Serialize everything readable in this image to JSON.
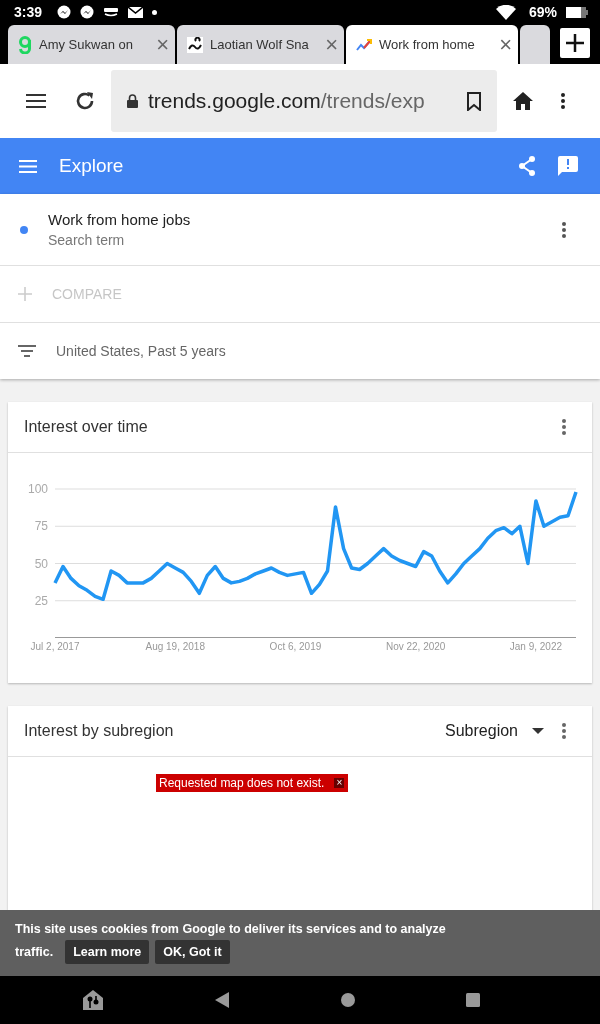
{
  "status_bar": {
    "time": "3:39",
    "battery": "69%"
  },
  "tabs": [
    {
      "title": "Amy Sukwan on",
      "selected": false,
      "kind": "letter-g",
      "close": "×"
    },
    {
      "title": "Laotian Wolf Sna",
      "selected": false,
      "kind": "snake",
      "close": "×"
    },
    {
      "title": "Work from home",
      "selected": true,
      "kind": "trends",
      "close": "×"
    }
  ],
  "toolbar": {
    "url_host": "trends.google.com",
    "url_path": "/trends/exp"
  },
  "header": {
    "title": "Explore"
  },
  "search_term": {
    "name": "Work from home jobs",
    "subtitle": "Search term",
    "color": "#4285f4"
  },
  "compare": {
    "label": "COMPARE"
  },
  "filter": {
    "label": "United States, Past 5 years"
  },
  "interest_over_time": {
    "title": "Interest over time",
    "chart_data": {
      "type": "line",
      "categories": [
        "Jul 2, 2017",
        null,
        null,
        null,
        null,
        null,
        null,
        null,
        null,
        null,
        null,
        null,
        null,
        null,
        null,
        "Aug 19, 2018",
        null,
        null,
        null,
        null,
        null,
        null,
        null,
        null,
        null,
        null,
        null,
        null,
        null,
        null,
        "Oct 6, 2019",
        null,
        null,
        null,
        null,
        null,
        null,
        null,
        null,
        null,
        null,
        null,
        null,
        null,
        null,
        "Nov 22, 2020",
        null,
        null,
        null,
        null,
        null,
        null,
        null,
        null,
        null,
        null,
        null,
        null,
        null,
        null,
        "Jan 9, 2022",
        null,
        null,
        null,
        null,
        null
      ],
      "series": [
        {
          "color": "#2196f3",
          "values": [
            37,
            48,
            40,
            35,
            32,
            28,
            26,
            45,
            42,
            37,
            37,
            37,
            40,
            45,
            50,
            47,
            44,
            38,
            30,
            42,
            48,
            40,
            37,
            38,
            40,
            43,
            45,
            47,
            44,
            42,
            43,
            44,
            30,
            36,
            45,
            88,
            60,
            47,
            46,
            50,
            55,
            60,
            55,
            52,
            50,
            48,
            58,
            55,
            45,
            37,
            43,
            50,
            55,
            60,
            67,
            72,
            74,
            70,
            75,
            50,
            92,
            75,
            78,
            81,
            82,
            98
          ]
        }
      ],
      "grid": true,
      "ylim": [
        0,
        100
      ],
      "yticks": [
        {
          "value": 25,
          "label": "25"
        },
        {
          "value": 50,
          "label": "50"
        },
        {
          "value": 75,
          "label": "75"
        },
        {
          "value": 100,
          "label": "100"
        }
      ]
    }
  },
  "interest_by_subregion": {
    "title": "Interest by subregion",
    "dropdown": "Subregion",
    "error": "Requested map does not exist.",
    "error_close": "×"
  },
  "cookie_banner": {
    "text_line1": "This site uses cookies from Google to deliver its services and to analyze",
    "text_line2": "traffic.",
    "buttons": [
      "Learn more",
      "OK, Got it"
    ]
  }
}
